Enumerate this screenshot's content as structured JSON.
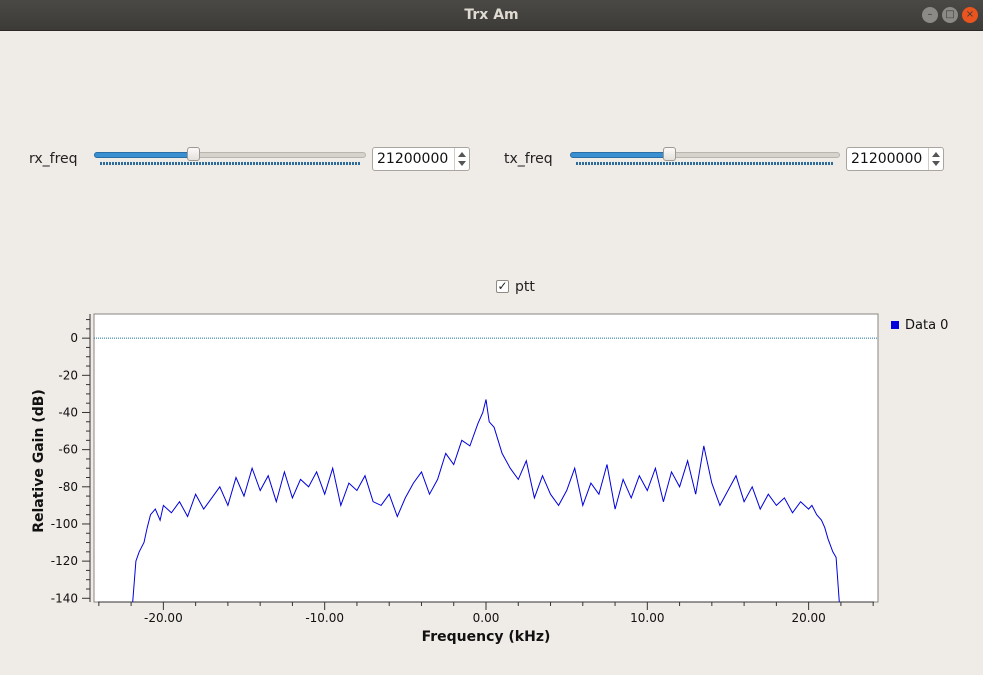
{
  "window": {
    "title": "Trx Am"
  },
  "controls": {
    "rx": {
      "label": "rx_freq",
      "value": "21200000",
      "level": 0.36
    },
    "tx": {
      "label": "tx_freq",
      "value": "21200000",
      "level": 0.36
    },
    "ptt": {
      "label": "ptt",
      "checked": true
    }
  },
  "chart_data": {
    "type": "line",
    "xlabel": "Frequency (kHz)",
    "ylabel": "Relative Gain (dB)",
    "xlim": [
      -24.3,
      24.3
    ],
    "ylim": [
      -142,
      13
    ],
    "x_ticks": [
      -20,
      -10,
      0,
      10,
      20
    ],
    "x_tick_labels": [
      "-20.00",
      "-10.00",
      "0.00",
      "10.00",
      "20.00"
    ],
    "y_ticks": [
      0,
      -20,
      -40,
      -60,
      -80,
      -100,
      -120,
      -140
    ],
    "y_tick_labels": [
      "0",
      "-20",
      "-40",
      "-60",
      "-80",
      "-100",
      "-120",
      "-140"
    ],
    "reference_line": 0,
    "legend": {
      "position": "top-right",
      "entries": [
        "Data 0"
      ]
    },
    "series": [
      {
        "name": "Data 0",
        "color": "#0000dd",
        "x": [
          -21.9,
          -21.7,
          -21.5,
          -21.2,
          -21.0,
          -20.8,
          -20.5,
          -20.2,
          -20.0,
          -19.5,
          -19.0,
          -18.5,
          -18.0,
          -17.5,
          -17.0,
          -16.5,
          -16.0,
          -15.5,
          -15.0,
          -14.5,
          -14.0,
          -13.5,
          -13.0,
          -12.5,
          -12.0,
          -11.5,
          -11.0,
          -10.5,
          -10.0,
          -9.5,
          -9.0,
          -8.5,
          -8.0,
          -7.5,
          -7.0,
          -6.5,
          -6.0,
          -5.5,
          -5.0,
          -4.5,
          -4.0,
          -3.5,
          -3.0,
          -2.5,
          -2.0,
          -1.5,
          -1.0,
          -0.5,
          -0.2,
          0.0,
          0.2,
          0.5,
          1.0,
          1.5,
          2.0,
          2.5,
          3.0,
          3.5,
          4.0,
          4.5,
          5.0,
          5.5,
          6.0,
          6.5,
          7.0,
          7.5,
          8.0,
          8.5,
          9.0,
          9.5,
          10.0,
          10.5,
          11.0,
          11.5,
          12.0,
          12.5,
          13.0,
          13.5,
          14.0,
          14.5,
          15.0,
          15.5,
          16.0,
          16.5,
          17.0,
          17.5,
          18.0,
          18.5,
          19.0,
          19.5,
          20.0,
          20.2,
          20.5,
          20.8,
          21.0,
          21.2,
          21.5,
          21.7,
          21.9
        ],
        "y": [
          -142,
          -120,
          -115,
          -110,
          -102,
          -95,
          -92,
          -98,
          -90,
          -94,
          -88,
          -96,
          -84,
          -92,
          -86,
          -80,
          -90,
          -75,
          -85,
          -70,
          -82,
          -74,
          -88,
          -72,
          -86,
          -76,
          -80,
          -72,
          -84,
          -70,
          -90,
          -78,
          -82,
          -74,
          -88,
          -90,
          -84,
          -96,
          -86,
          -78,
          -72,
          -84,
          -76,
          -62,
          -68,
          -55,
          -58,
          -46,
          -40,
          -33,
          -45,
          -48,
          -62,
          -70,
          -76,
          -66,
          -86,
          -74,
          -84,
          -90,
          -82,
          -70,
          -90,
          -78,
          -84,
          -68,
          -92,
          -76,
          -86,
          -74,
          -82,
          -70,
          -88,
          -72,
          -80,
          -66,
          -84,
          -58,
          -78,
          -90,
          -82,
          -74,
          -88,
          -80,
          -92,
          -84,
          -90,
          -86,
          -94,
          -88,
          -92,
          -90,
          -95,
          -98,
          -102,
          -108,
          -115,
          -118,
          -142
        ]
      }
    ]
  }
}
